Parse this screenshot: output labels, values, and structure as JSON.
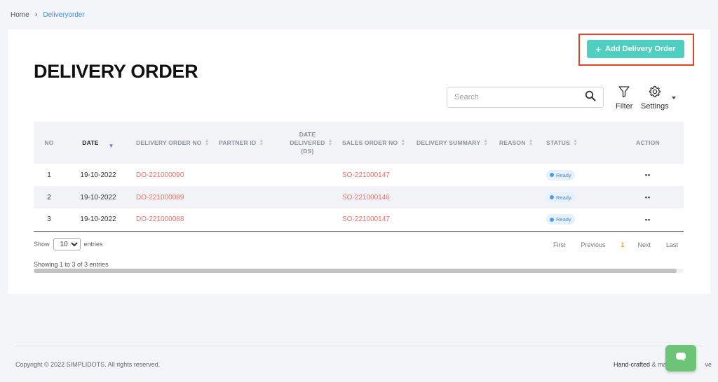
{
  "breadcrumb": {
    "home": "Home",
    "separator": "›",
    "current": "Deliveryorder"
  },
  "header": {
    "title": "DELIVERY ORDER",
    "add_button": "Add Delivery Order",
    "add_button_icon": "plus-icon"
  },
  "toolbar": {
    "search_placeholder": "Search",
    "filter_label": "Filter",
    "settings_label": "Settings"
  },
  "table": {
    "columns": [
      "NO",
      "DATE",
      "DELIVERY ORDER NO",
      "PARTNER ID",
      "DATE DELIVERED (DS)",
      "SALES ORDER NO",
      "DELIVERY SUMMARY",
      "REASON",
      "STATUS",
      "ACTION"
    ],
    "date_delivered_lines": [
      "DATE",
      "DELIVERED",
      "(DS)"
    ],
    "rows": [
      {
        "no": "1",
        "date": "19-10-2022",
        "do_no": "DO-221000090",
        "partner_id": "",
        "date_delivered": "",
        "so_no": "SO-221000147",
        "summary": "",
        "reason": "",
        "status": "Ready",
        "action": "••"
      },
      {
        "no": "2",
        "date": "19-10-2022",
        "do_no": "DO-221000089",
        "partner_id": "",
        "date_delivered": "",
        "so_no": "SO-221000146",
        "summary": "",
        "reason": "",
        "status": "Ready",
        "action": "••"
      },
      {
        "no": "3",
        "date": "19-10-2022",
        "do_no": "DO-221000088",
        "partner_id": "",
        "date_delivered": "",
        "so_no": "SO-221000147",
        "summary": "",
        "reason": "",
        "status": "Ready",
        "action": "••"
      }
    ]
  },
  "pagination": {
    "show_label": "Show",
    "entries_label": "entries",
    "page_size": "10",
    "first": "First",
    "previous": "Previous",
    "current_page": "1",
    "next": "Next",
    "last": "Last",
    "info": "Showing 1 to 3 of 3 entries"
  },
  "footer": {
    "copyright": "Copyright © 2022 SIMPLIDOTS. All rights reserved.",
    "handcrafted_bold": "Hand-crafted",
    "handcrafted_rest": " & ma",
    "handcrafted_tail": "ve"
  },
  "colors": {
    "accent": "#4fcfc0",
    "link": "#e7726a",
    "highlight_border": "#e0452a",
    "status_ready": "#3d8fd6",
    "pager_current": "#e8a315",
    "chat": "#6cc477"
  }
}
